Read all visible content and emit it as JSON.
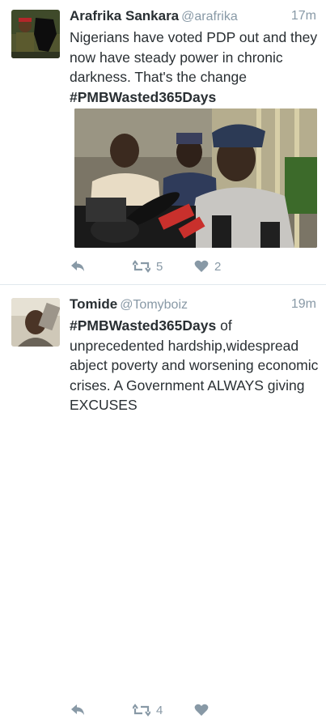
{
  "tweets": [
    {
      "name": "Arafrika Sankara",
      "handle": "@arafrika",
      "time": "17m",
      "text": "Nigerians have voted PDP out and they now have steady power in chronic darkness. That's the change",
      "hashtag": "#PMBWasted365Days",
      "retweets": "5",
      "likes": "2"
    },
    {
      "name": "Tomide",
      "handle": "@Tomyboiz",
      "time": "19m",
      "hashtag": "#PMBWasted365Days",
      "text": "of unprecedented hardship,widespread abject poverty and worsening economic crises. A Government ALWAYS  giving EXCUSES",
      "retweets": "4",
      "likes": ""
    }
  ],
  "colors": {
    "text": "#292f33",
    "muted": "#8899a6",
    "divider": "#e1e8ed"
  },
  "icons": [
    "reply-icon",
    "retweet-icon",
    "heart-icon"
  ]
}
